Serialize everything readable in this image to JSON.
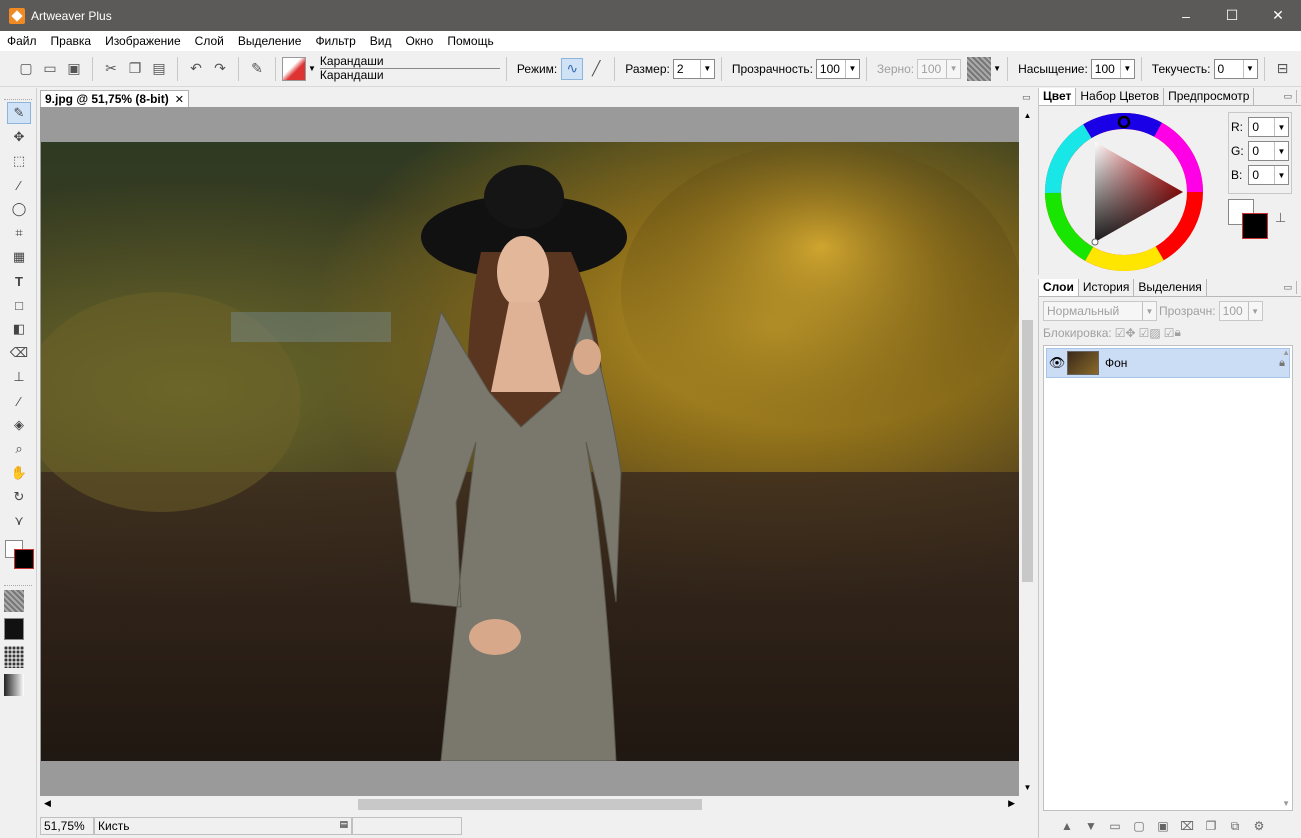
{
  "app": {
    "title": "Artweaver Plus"
  },
  "window_controls": {
    "minimize": "–",
    "maximize": "☐",
    "close": "✕"
  },
  "menu": [
    "Файл",
    "Правка",
    "Изображение",
    "Слой",
    "Выделение",
    "Фильтр",
    "Вид",
    "Окно",
    "Помощь"
  ],
  "toolbar": {
    "brush_category": "Карандаши",
    "brush_variant": "Карандаши",
    "mode_label": "Режим:",
    "size_label": "Размер:",
    "size_value": "2",
    "opacity_label": "Прозрачность:",
    "opacity_value": "100",
    "grain_label": "Зерно:",
    "grain_value": "100",
    "saturation_label": "Насыщение:",
    "saturation_value": "100",
    "flow_label": "Текучесть:",
    "flow_value": "0"
  },
  "document": {
    "tab_title": "9.jpg @ 51,75% (8-bit)"
  },
  "status": {
    "zoom": "51,75%",
    "tool": "Кисть"
  },
  "color_panel": {
    "tabs": [
      "Цвет",
      "Набор Цветов",
      "Предпросмотр"
    ],
    "r_label": "R:",
    "r_value": "0",
    "g_label": "G:",
    "g_value": "0",
    "b_label": "B:",
    "b_value": "0",
    "foreground": "#000000",
    "background": "#ffffff"
  },
  "layers_panel": {
    "tabs": [
      "Слои",
      "История",
      "Выделения"
    ],
    "blend_mode": "Нормальный",
    "opacity_label": "Прозрачн:",
    "opacity_value": "100",
    "lock_label": "Блокировка:",
    "layers": [
      {
        "name": "Фон"
      }
    ]
  },
  "colors": {
    "accent": "#cbdcf5",
    "titlebar": "#5c5a58"
  }
}
